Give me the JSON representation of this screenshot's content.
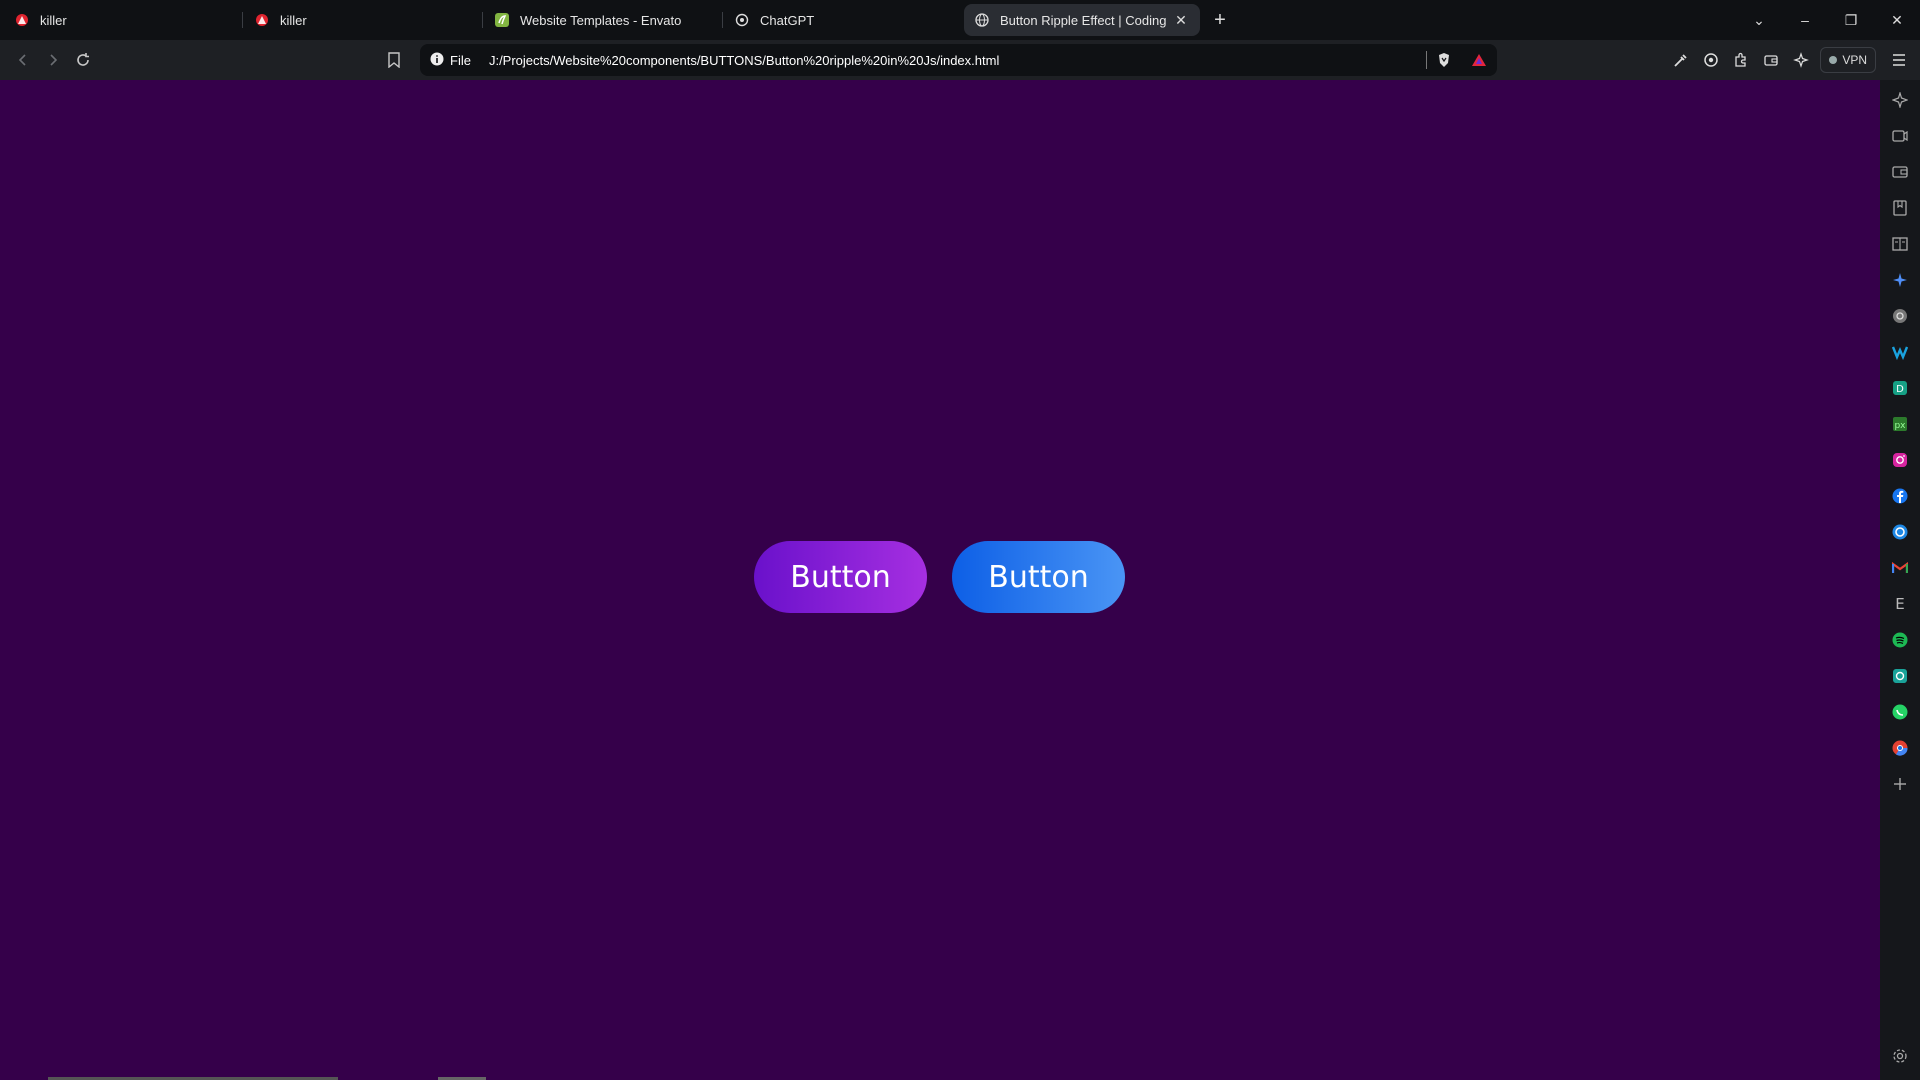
{
  "tabs": [
    {
      "title": "killer",
      "icon": "opera-red-icon",
      "active": false
    },
    {
      "title": "killer",
      "icon": "opera-red-icon",
      "active": false
    },
    {
      "title": "Website Templates - Envato",
      "icon": "envato-icon",
      "active": false
    },
    {
      "title": "ChatGPT",
      "icon": "chatgpt-icon",
      "active": false
    },
    {
      "title": "Button Ripple Effect | Coding U",
      "icon": "globe-icon",
      "active": true
    }
  ],
  "address_bar": {
    "scheme_label": "File",
    "url": "J:/Projects/Website%20components/BUTTONS/Button%20ripple%20in%20Js/index.html"
  },
  "toolbar": {
    "vpn_label": "VPN"
  },
  "page": {
    "button1_label": "Button",
    "button2_label": "Button",
    "background_color": "#35004a",
    "button1_gradient": [
      "#6a11cb",
      "#a62fe1"
    ],
    "button2_gradient": [
      "#0d5fe6",
      "#4a95f5"
    ]
  },
  "sidebar": {
    "icons": [
      "leo-ai-icon",
      "video-icon",
      "wallet-icon",
      "bookmarks-icon",
      "reading-list-icon",
      "ai-sparkle-icon",
      "chatgpt-icon",
      "malwarebytes-icon",
      "evernote-icon",
      "pixel-app-icon",
      "instagram-icon",
      "facebook-icon",
      "messenger-icon",
      "gmail-icon",
      "envato-e-icon",
      "spotify-icon",
      "threads-icon",
      "whatsapp-icon",
      "chrome-icon",
      "add-icon",
      "settings-icon"
    ]
  }
}
